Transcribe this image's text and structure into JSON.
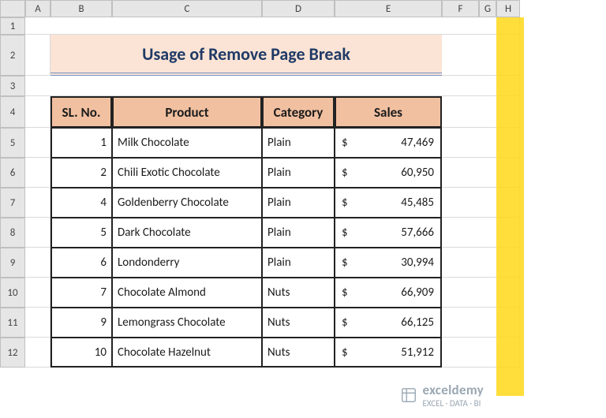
{
  "columns": [
    "A",
    "B",
    "C",
    "D",
    "E",
    "F",
    "G",
    "H"
  ],
  "rows": [
    "1",
    "2",
    "3",
    "4",
    "5",
    "6",
    "7",
    "8",
    "9",
    "10",
    "11",
    "12"
  ],
  "title": "Usage of Remove Page Break",
  "headers": {
    "sl": "SL. No.",
    "product": "Product",
    "category": "Category",
    "sales": "Sales"
  },
  "currency": "$",
  "data": [
    {
      "sl": "1",
      "product": "Milk Chocolate",
      "category": "Plain",
      "sales": "47,469"
    },
    {
      "sl": "2",
      "product": "Chili Exotic Chocolate",
      "category": "Plain",
      "sales": "60,950"
    },
    {
      "sl": "4",
      "product": "Goldenberry Chocolate",
      "category": "Plain",
      "sales": "45,485"
    },
    {
      "sl": "5",
      "product": "Dark Chocolate",
      "category": "Plain",
      "sales": "57,666"
    },
    {
      "sl": "6",
      "product": "Londonderry",
      "category": "Plain",
      "sales": "30,994"
    },
    {
      "sl": "7",
      "product": "Chocolate Almond",
      "category": "Nuts",
      "sales": "66,909"
    },
    {
      "sl": "9",
      "product": "Lemongrass Chocolate",
      "category": "Nuts",
      "sales": "66,125"
    },
    {
      "sl": "10",
      "product": "Chocolate Hazelnut",
      "category": "Nuts",
      "sales": "51,912"
    }
  ],
  "watermark": {
    "name": "exceldemy",
    "tag": "EXCEL · DATA · BI"
  },
  "chart_data": {
    "type": "table",
    "title": "Usage of Remove Page Break",
    "columns": [
      "SL. No.",
      "Product",
      "Category",
      "Sales"
    ],
    "rows": [
      [
        1,
        "Milk Chocolate",
        "Plain",
        47469
      ],
      [
        2,
        "Chili Exotic Chocolate",
        "Plain",
        60950
      ],
      [
        4,
        "Goldenberry Chocolate",
        "Plain",
        45485
      ],
      [
        5,
        "Dark Chocolate",
        "Plain",
        57666
      ],
      [
        6,
        "Londonderry",
        "Plain",
        30994
      ],
      [
        7,
        "Chocolate Almond",
        "Nuts",
        66909
      ],
      [
        9,
        "Lemongrass Chocolate",
        "Nuts",
        66125
      ],
      [
        10,
        "Chocolate Hazelnut",
        "Nuts",
        51912
      ]
    ]
  }
}
